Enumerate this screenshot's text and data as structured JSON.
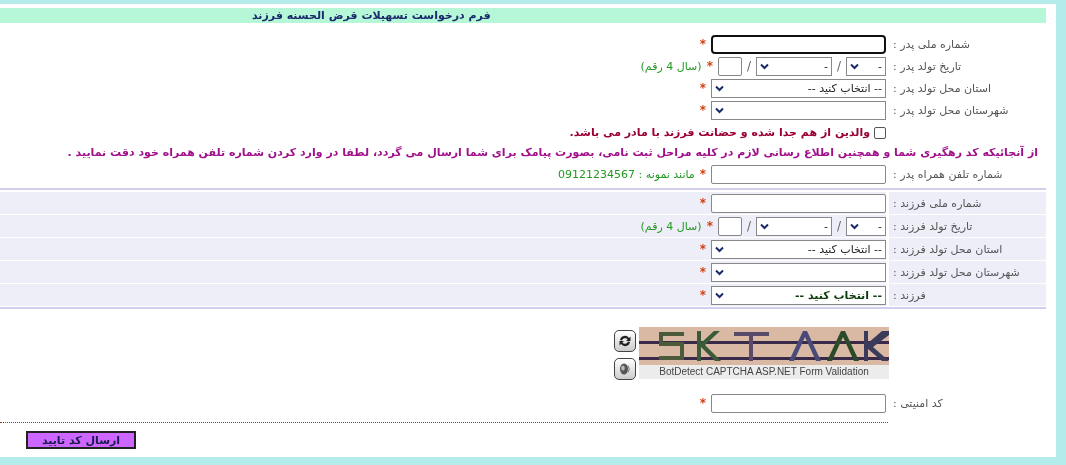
{
  "form_title": "فرم درخواست تسهیلات قرض الحسنه فرزند",
  "father_fields": [
    {
      "kind": "text",
      "label": "شماره ملی پدر :",
      "star": "*",
      "focused": true
    },
    {
      "kind": "date",
      "label": "تاریخ تولد پدر :",
      "day": "-",
      "month": "-",
      "separators": [
        "/",
        "/"
      ],
      "star": "*",
      "hint": "(سال 4 رقم)"
    },
    {
      "kind": "select",
      "label": "استان محل تولد پدر :",
      "value": "-- انتخاب کنید --",
      "star": "*"
    },
    {
      "kind": "select",
      "label": "شهرستان محل تولد پدر :",
      "star": "*"
    }
  ],
  "separated_checkbox": {
    "label": "والدین از هم جدا شده و حضانت فرزند با مادر می باشد.",
    "checked": false
  },
  "notice": "از آنجائیکه کد رهگیری شما و همچنین اطلاع رسانی لازم در کلیه مراحل ثبت نامی، بصورت پیامک برای شما ارسال می گردد، لطفا در وارد کردن شماره تلفن همراه خود دقت نمایید .",
  "phone_field": {
    "kind": "text",
    "label": "شماره تلفن همراه پدر :",
    "star": "*",
    "hint": "مانند نمونه : 09121234567"
  },
  "child_fields": [
    {
      "kind": "text",
      "label": "شماره ملی فرزند :",
      "star": "*"
    },
    {
      "kind": "date",
      "label": "تاریخ تولد فرزند :",
      "day": "-",
      "month": "-",
      "separators": [
        "/",
        "/"
      ],
      "star": "*",
      "hint": "(سال 4 رقم)"
    },
    {
      "kind": "select",
      "label": "استان محل تولد فرزند :",
      "value": "-- انتخاب کنید --",
      "star": "*"
    },
    {
      "kind": "select",
      "label": "شهرستان محل تولد فرزند :",
      "star": "*"
    },
    {
      "kind": "select",
      "label": "فرزند :",
      "value": "-- انتخاب کنید --",
      "emphasized": true,
      "star": "*"
    }
  ],
  "captcha": {
    "caption": "BotDetect CAPTCHA ASP.NET Form Validation"
  },
  "security_field": {
    "kind": "text",
    "label": "کد امنیتی :",
    "star": "*"
  },
  "submit_button": "ارسال کد تایید"
}
